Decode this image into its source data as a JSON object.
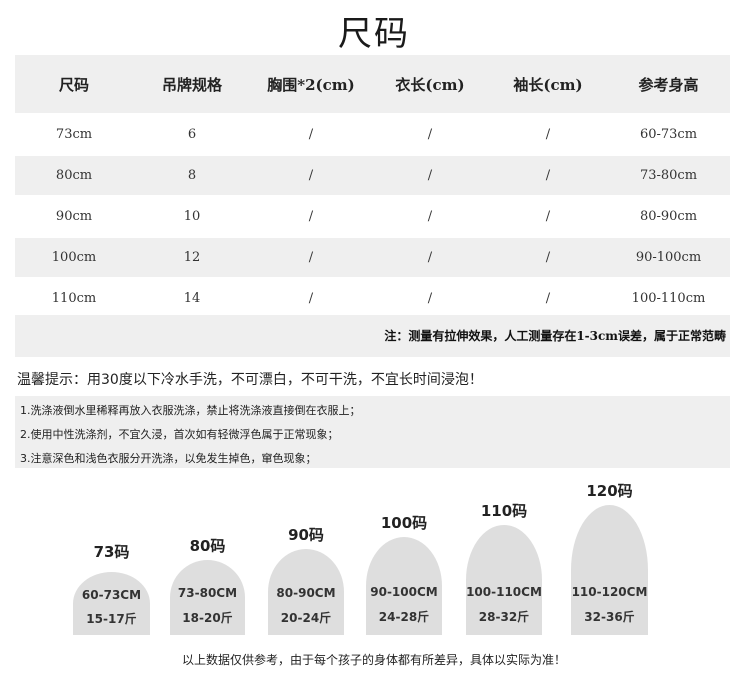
{
  "page": {
    "title": "尺码"
  },
  "table": {
    "headers": [
      "尺码",
      "吊牌规格",
      "胸围*2(cm)",
      "衣长(cm)",
      "袖长(cm)",
      "参考身高"
    ],
    "rows": [
      [
        "73cm",
        "6",
        "/",
        "/",
        "/",
        "60-73cm"
      ],
      [
        "80cm",
        "8",
        "/",
        "/",
        "/",
        "73-80cm"
      ],
      [
        "90cm",
        "10",
        "/",
        "/",
        "/",
        "80-90cm"
      ],
      [
        "100cm",
        "12",
        "/",
        "/",
        "/",
        "90-100cm"
      ],
      [
        "110cm",
        "14",
        "/",
        "/",
        "/",
        "100-110cm"
      ]
    ],
    "note": "注：测量有拉伸效果，人工测量存在1-3cm误差，属于正常范畴"
  },
  "care": {
    "tip": "温馨提示：用30度以下冷水手洗，不可漂白，不可干洗，不宜长时间浸泡！",
    "items": [
      "1.洗涤液倒水里稀释再放入衣服洗涤，禁止将洗涤液直接倒在衣服上；",
      "2.使用中性洗涤剂，不宜久浸，首次如有轻微浮色属于正常现象；",
      "3.注意深色和浅色衣服分开洗涤，以免发生掉色，窜色现象；"
    ]
  },
  "domes": [
    {
      "size": "73码",
      "range": "60-73CM",
      "weight": "15-17斤"
    },
    {
      "size": "80码",
      "range": "73-80CM",
      "weight": "18-20斤"
    },
    {
      "size": "90码",
      "range": "80-90CM",
      "weight": "20-24斤"
    },
    {
      "size": "100码",
      "range": "90-100CM",
      "weight": "24-28斤"
    },
    {
      "size": "110码",
      "range": "100-110CM",
      "weight": "28-32斤"
    },
    {
      "size": "120码",
      "range": "110-120CM",
      "weight": "32-36斤"
    }
  ],
  "footer": {
    "note": "以上数据仅供参考，由于每个孩子的身体都有所差异，具体以实际为准！"
  }
}
